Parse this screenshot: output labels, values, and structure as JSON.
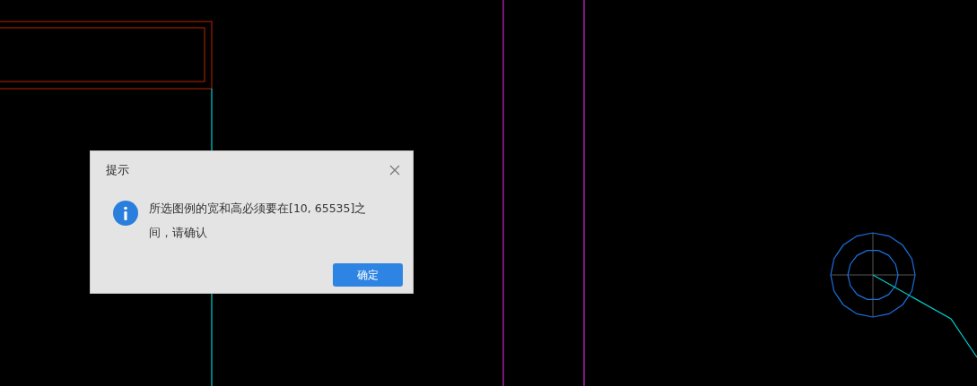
{
  "dialog": {
    "title": "提示",
    "message": "所选图例的宽和高必须要在[10, 65535]之间，请确认",
    "buttons": [
      {
        "label": "确定",
        "kind": "primary"
      }
    ]
  }
}
